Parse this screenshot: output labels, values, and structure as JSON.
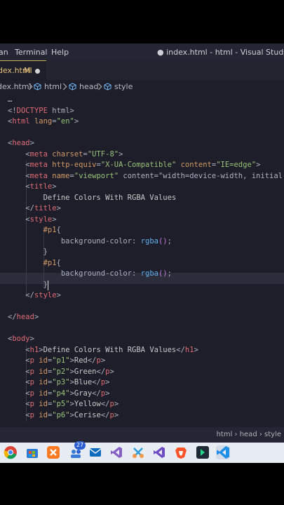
{
  "menubar": {
    "items": [
      "an",
      "Terminal",
      "Help"
    ],
    "window_title": "● index.html - html - Visual Studio Code"
  },
  "tab": {
    "filename": "dex.html",
    "modified_marker": "M"
  },
  "breadcrumb": {
    "file": "dex.html",
    "items": [
      "html",
      "head",
      "style"
    ]
  },
  "editor": {
    "lines": [
      "…",
      "<!DOCTYPE html>",
      "<html lang=\"en\">",
      "",
      "<head>",
      "    <meta charset=\"UTF-8\">",
      "    <meta http-equiv=\"X-UA-Compatible\" content=\"IE=edge\">",
      "    <meta name=\"viewport\" content=\"width=device-width, initial-s",
      "    <title>",
      "        Define Colors With RGBA Values",
      "    </title>",
      "    <style>",
      "        #p1{",
      "            background-color: rgba();",
      "        }",
      "        #p1{",
      "            background-color: rgba();",
      "        }",
      "    </style>",
      "",
      "</head>",
      "",
      "<body>",
      "    <h1>Define Colors With RGBA Values</h1>",
      "    <p id=\"p1\">Red</p>",
      "    <p id=\"p2\">Green</p>",
      "    <p id=\"p3\">Blue</p>",
      "    <p id=\"p4\">Gray</p>",
      "    <p id=\"p5\">Yellow</p>",
      "    <p id=\"p6\">Cerise</p>"
    ]
  },
  "statusbar": {
    "breadcrumb": "html › head › style"
  },
  "taskbar": {
    "icons": [
      "chrome-icon",
      "store-icon",
      "xampp-icon",
      "people-icon",
      "mail-icon",
      "visual-studio-icon",
      "snipping-tool-icon",
      "visual-studio-2-icon",
      "brave-icon",
      "app-icon",
      "vscode-icon"
    ],
    "badge_count": "27"
  },
  "colors": {
    "editor_bg": "#1e1e2a",
    "tag": "#e06c75",
    "attribute": "#d19a66",
    "string": "#98c379",
    "function": "#61afef",
    "paren": "#c678dd"
  }
}
